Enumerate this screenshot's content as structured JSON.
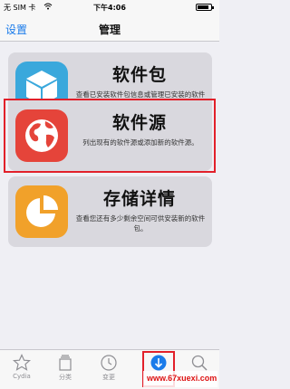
{
  "status_bar": {
    "carrier": "无 SIM 卡",
    "time": "下午4:06",
    "battery_level": 0.85
  },
  "nav": {
    "back_label": "设置",
    "title": "管理"
  },
  "cards": [
    {
      "title": "软件包",
      "description": "查看已安装软件包信息或管理已安装的软件包。",
      "icon": "package-box-icon",
      "icon_color": "#3aa8dc"
    },
    {
      "title": "软件源",
      "description": "列出现有的软件源或添加新的软件源。",
      "icon": "globe-icon",
      "icon_color": "#e5443a",
      "highlighted": true
    },
    {
      "title": "存储详情",
      "description": "查看您还有多少剩余空间可供安装新的软件包。",
      "icon": "pie-chart-icon",
      "icon_color": "#f1a12a"
    }
  ],
  "tabs": [
    {
      "label": "Cydia",
      "icon": "star-icon"
    },
    {
      "label": "分类",
      "icon": "categories-icon"
    },
    {
      "label": "变更",
      "icon": "clock-icon"
    },
    {
      "label": "",
      "icon": "download-icon",
      "active": true
    },
    {
      "label": "",
      "icon": "search-icon"
    }
  ],
  "watermark": "www.67xuexi.com",
  "colors": {
    "accent": "#1a7bea",
    "highlight_border": "#e2202a"
  }
}
